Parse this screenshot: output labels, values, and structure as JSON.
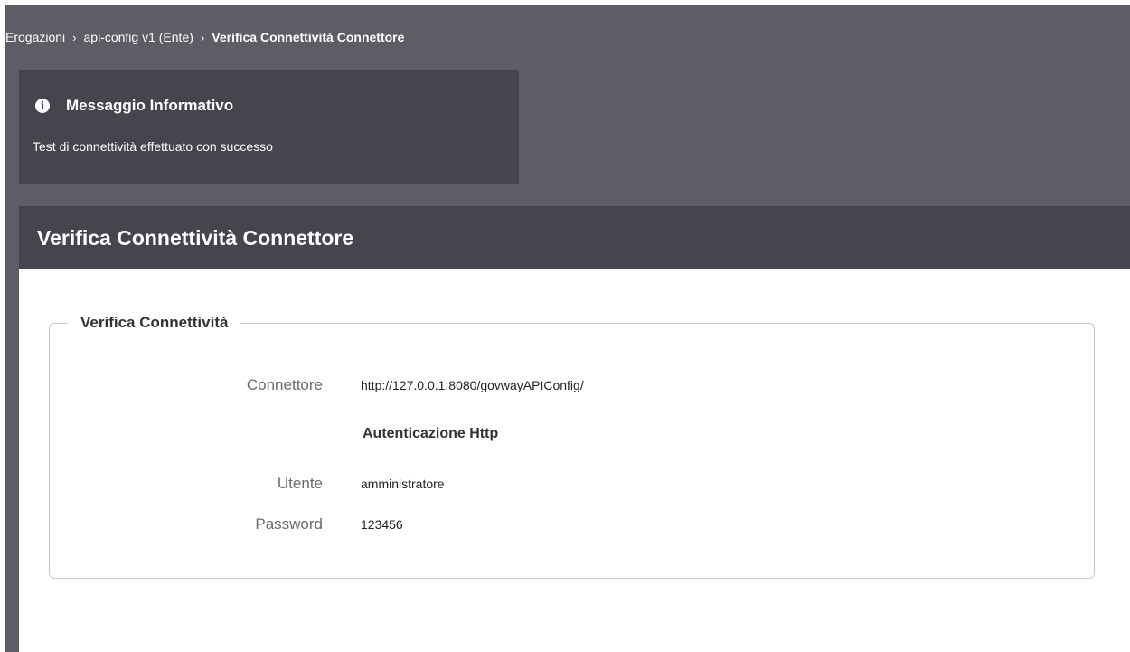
{
  "breadcrumb": {
    "items": [
      "Erogazioni",
      "api-config v1 (Ente)"
    ],
    "separator": "›",
    "current": "Verifica Connettività Connettore"
  },
  "info": {
    "icon": "info-circle-icon",
    "title": "Messaggio Informativo",
    "message": "Test di connettività effettuato con successo"
  },
  "panel": {
    "title": "Verifica Connettività Connettore",
    "fieldset": {
      "legend": "Verifica Connettività",
      "connettore_label": "Connettore",
      "connettore_value": "http://127.0.0.1:8080/govwayAPIConfig/",
      "subheading": "Autenticazione Http",
      "utente_label": "Utente",
      "utente_value": "amministratore",
      "password_label": "Password",
      "password_value": "123456"
    }
  },
  "colors": {
    "page_background": "#5e5d66",
    "dark_panel": "#46454d",
    "content_background": "#ffffff"
  }
}
